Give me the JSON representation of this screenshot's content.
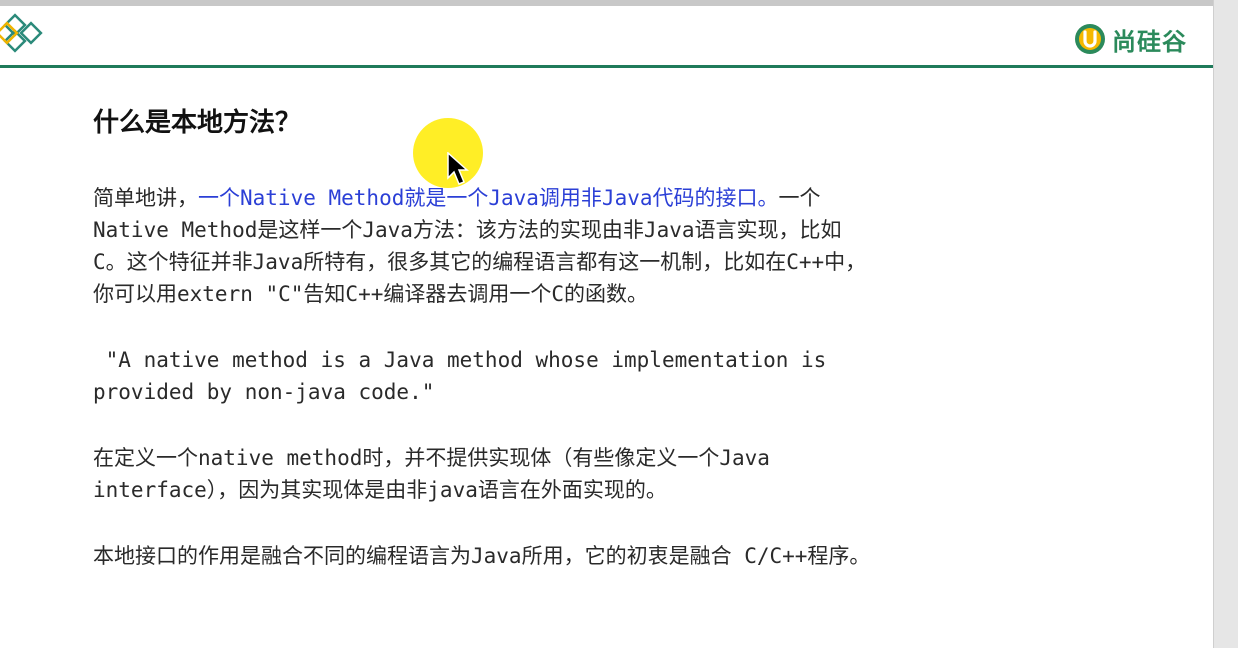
{
  "header": {
    "brand_text": "尚硅谷",
    "accent_color": "#1f7a5a",
    "brand_color": "#2b8a5b",
    "corner_icon": "diamond-pattern-icon",
    "brand_icon": "u-logo-icon"
  },
  "slide": {
    "title": "什么是本地方法？",
    "p1": {
      "lead": "简单地讲，",
      "highlight": "一个Native Method就是一个Java调用非Java代码的接口。",
      "rest_line1_tail": "一个",
      "line2": "Native Method是这样一个Java方法：该方法的实现由非Java语言实现，比如",
      "line3": "C。这个特征并非Java所特有，很多其它的编程语言都有这一机制，比如在C++中，",
      "line4": "你可以用extern \"C\"告知C++编译器去调用一个C的函数。"
    },
    "p2": {
      "line1": " \"A native method is a Java method whose implementation is",
      "line2": "provided by non-java code.\""
    },
    "p3": {
      "line1": "在定义一个native method时，并不提供实现体（有些像定义一个Java",
      "line2": "interface），因为其实现体是由非java语言在外面实现的。"
    },
    "p4": {
      "line1": "本地接口的作用是融合不同的编程语言为Java所用，它的初衷是融合 C/C++程序。"
    },
    "highlight_color": "#2b3fd6",
    "cursor_icon": "mouse-pointer-icon"
  }
}
